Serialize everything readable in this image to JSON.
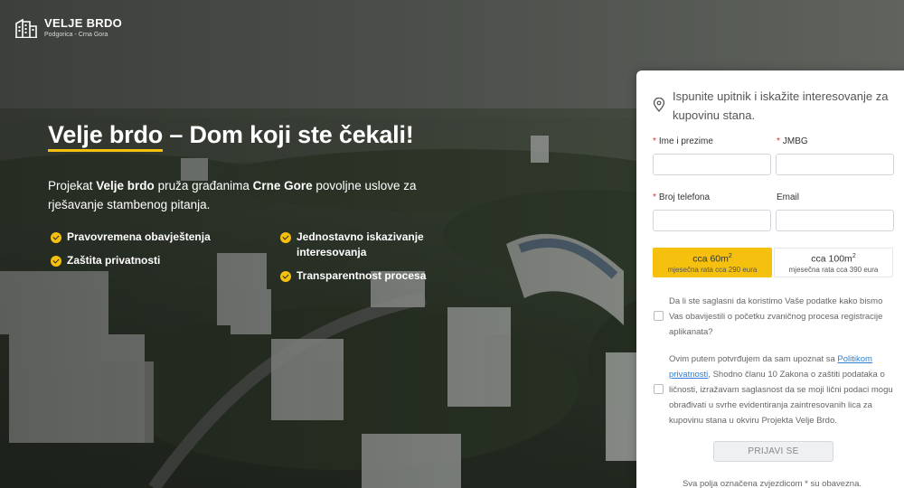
{
  "brand": {
    "name": "VELJE BRDO",
    "location": "Podgorica - Crna Gora"
  },
  "hero": {
    "title_highlight": "Velje brdo",
    "title_rest": " – Dom koji ste čekali!",
    "text_1": "Projekat ",
    "text_b1": "Velje brdo",
    "text_2": " pruža građanima ",
    "text_b2": "Crne Gore",
    "text_3": " povoljne uslove za rješavanje stambenog pitanja.",
    "features": [
      "Pravovremena obavještenja",
      "Jednostavno iskazivanje interesovanja",
      "Zaštita privatnosti",
      "Transparentnost procesa"
    ],
    "check_color": "#f5c10e"
  },
  "form": {
    "title": "Ispunite upitnik i iskažite interesovanje za kupovinu stana.",
    "required_mark": "*",
    "fields": {
      "name": {
        "label": "Ime i prezime",
        "value": ""
      },
      "jmbg": {
        "label": "JMBG",
        "value": ""
      },
      "phone": {
        "label": "Broj telefona",
        "value": ""
      },
      "email": {
        "label": "Email",
        "value": ""
      }
    },
    "options": [
      {
        "area": "cca 60m",
        "unit_sup": "2",
        "rate": "mjesečna rata cca 290 eura",
        "selected": true
      },
      {
        "area": "cca 100m",
        "unit_sup": "2",
        "rate": "mjesečna rata cca 390 eura",
        "selected": false
      }
    ],
    "consent_1": "Da li ste saglasni da koristimo Vaše podatke kako bismo Vas obavijestili o početku zvaničnog procesa registracije aplikanata?",
    "consent_2_before": "Ovim putem potvrđujem da sam upoznat sa ",
    "consent_2_link": "Politikom privatnosti",
    "consent_2_after": ", Shodno članu 10 Zakona o zaštiti podataka o ličnosti, izražavam saglasnost da se moji lični podaci mogu obrađivati u svrhe evidentiranja zaintresovanih lica za kupovinu stana u okviru Projekta Velje Brdo.",
    "submit_label": "PRIJAVI SE",
    "footnote": "Sva polja označena zvjezdicom * su obavezna.",
    "accent_color": "#f5c10e",
    "link_color": "#2b7fd6"
  }
}
